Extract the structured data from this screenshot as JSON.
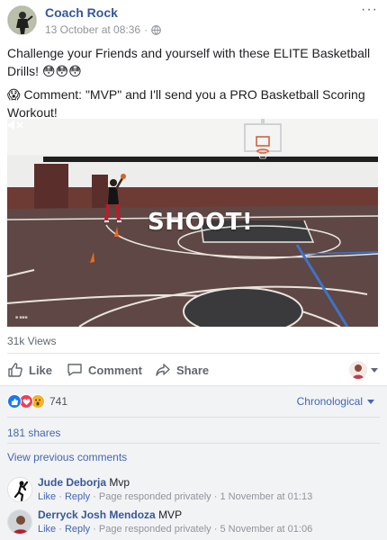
{
  "post": {
    "author": "Coach Rock",
    "timestamp": "13 October at 08:36",
    "separator": "·",
    "privacy_icon": "globe-icon",
    "more_icon": "···",
    "line1": "Challenge your Friends and yourself with these ELITE Basketball Drills! 😳😳😳",
    "line2": "😱 Comment: \"MVP\" and I'll send you a PRO Basketball Scoring Workout!"
  },
  "video": {
    "overlay": "SHOOT!",
    "mute_icon": "muted-speaker-icon",
    "views": "31k Views"
  },
  "actions": {
    "like": "Like",
    "comment": "Comment",
    "share": "Share"
  },
  "reactions": {
    "types": [
      "like",
      "love",
      "wow"
    ],
    "count": "741",
    "sort": "Chronological"
  },
  "shares": "181 shares",
  "view_previous": "View previous comments",
  "comments": [
    {
      "name": "Jude Deborja",
      "text": "Mvp",
      "like": "Like",
      "reply": "Reply",
      "dot": "·",
      "responded": "Page responded privately",
      "time": "1 November at 01:13"
    },
    {
      "name": "Derryck Josh Mendoza",
      "text": "MVP",
      "like": "Like",
      "reply": "Reply",
      "dot": "·",
      "responded": "Page responded privately",
      "time": "5 November at 01:06"
    }
  ],
  "colors": {
    "link": "#365899",
    "accent": "#4267b2",
    "meta": "#90949c",
    "court": "#5a4643"
  }
}
